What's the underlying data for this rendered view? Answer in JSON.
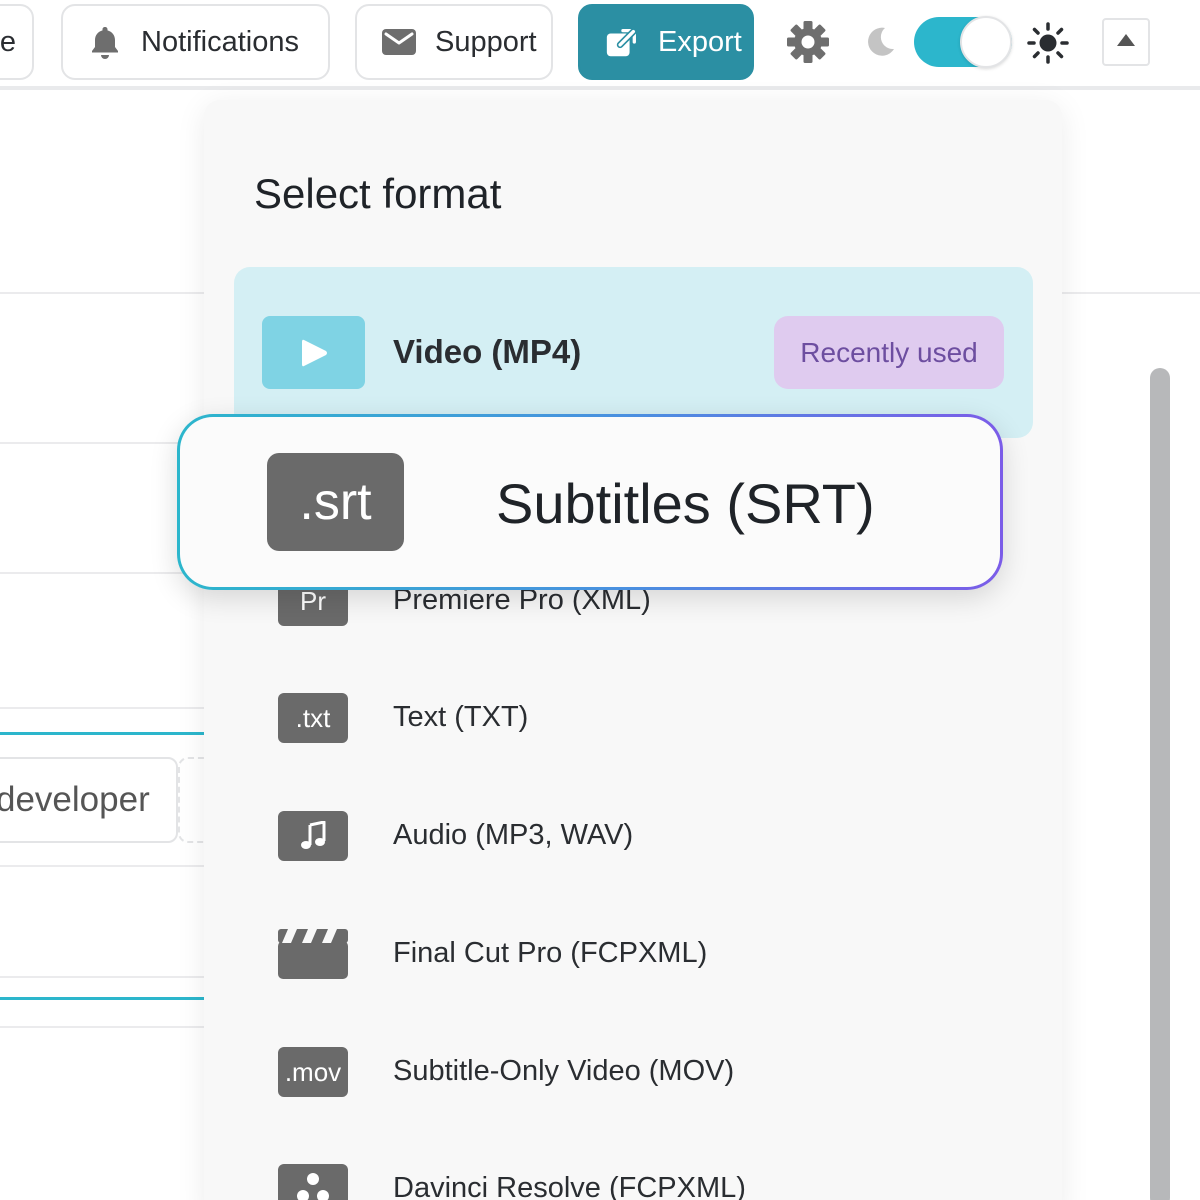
{
  "toolbar": {
    "truncated_label": "le",
    "notifications_label": "Notifications",
    "support_label": "Support",
    "export_label": "Export",
    "theme_toggle": {
      "state": "on"
    },
    "icons": {
      "notifications": "bell-icon",
      "support": "mail-icon",
      "export": "external-link-icon",
      "settings": "gear-icon",
      "dark_mode": "moon-icon",
      "light_mode": "sun-icon",
      "collapse": "chevron-up-icon"
    }
  },
  "background": {
    "chip_text": "developer"
  },
  "dropdown": {
    "title": "Select format",
    "selected": {
      "icon_text": ".srt",
      "label": "Subtitles (SRT)"
    },
    "recent": {
      "icon": "play-icon",
      "label": "Video (MP4)",
      "badge": "Recently used"
    },
    "items": [
      {
        "icon_text": "Pr",
        "label": "Premiere Pro (XML)"
      },
      {
        "icon_text": ".txt",
        "label": "Text (TXT)"
      },
      {
        "icon_text": "",
        "icon": "music-note-icon",
        "label": "Audio (MP3, WAV)"
      },
      {
        "icon_text": "",
        "icon": "clapperboard-icon",
        "label": "Final Cut Pro (FCPXML)"
      },
      {
        "icon_text": ".mov",
        "label": "Subtitle-Only Video (MOV)"
      },
      {
        "icon_text": "",
        "icon": "davinci-icon",
        "label": "Davinci Resolve (FCPXML)"
      }
    ]
  },
  "colors": {
    "accent": "#2b8fa3",
    "toggle": "#2cb6cc",
    "recent_row_bg": "#d4eff4",
    "badge_bg": "#dfcbef",
    "badge_text": "#6d4ea0",
    "icon_tile": "#6a6a6a"
  }
}
